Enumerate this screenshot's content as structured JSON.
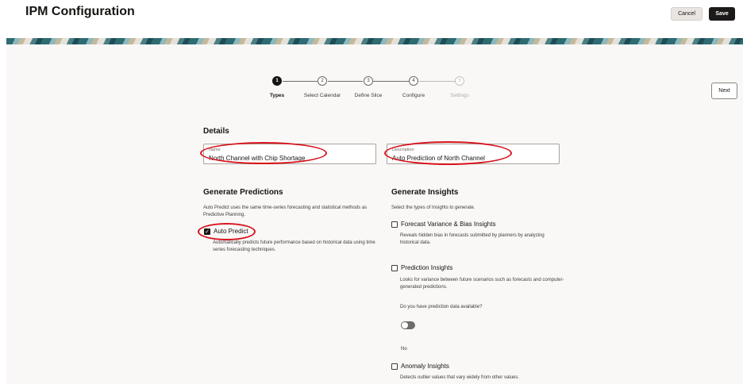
{
  "header": {
    "title": "IPM Configuration",
    "cancel_label": "Cancel",
    "save_label": "Save"
  },
  "train": {
    "steps": [
      {
        "number": "1",
        "label": "Types",
        "state": "active"
      },
      {
        "number": "2",
        "label": "Select Calendar",
        "state": "enabled"
      },
      {
        "number": "3",
        "label": "Define Slice",
        "state": "enabled"
      },
      {
        "number": "4",
        "label": "Configure",
        "state": "enabled"
      },
      {
        "number": "5",
        "label": "Settings",
        "state": "disabled"
      }
    ],
    "next_label": "Next"
  },
  "details": {
    "heading": "Details",
    "name": {
      "label": "Name",
      "value": "North Channel with Chip Shortage"
    },
    "description": {
      "label": "Description",
      "value": "Auto Prediction of North Channel"
    }
  },
  "predictions": {
    "heading": "Generate Predictions",
    "intro": "Auto Predict uses the same time-series forecasting and statistical methods as Predictive Planning.",
    "auto_predict": {
      "label": "Auto Predict",
      "checked": true,
      "help": "Automatically predicts future performance based on historical data using time series forecasting techniques."
    }
  },
  "insights": {
    "heading": "Generate Insights",
    "intro": "Select the types of Insights to generate.",
    "forecast_variance": {
      "label": "Forecast Variance & Bias Insights",
      "checked": false,
      "help": "Reveals hidden bias in forecasts submitted by planners by analyzing historical data."
    },
    "prediction": {
      "label": "Prediction Insights",
      "checked": false,
      "help": "Looks for variance between future scenarios such as forecasts and computer-generated predictions."
    },
    "prediction_data_question": "Do you have prediction data available?",
    "prediction_data_toggle_value": "No",
    "anomaly": {
      "label": "Anomaly Insights",
      "checked": false,
      "help": "Detects outlier values that vary widely from other values."
    }
  },
  "colors": {
    "annotation_red": "#d8121b",
    "primary_dark": "#1c1a18",
    "panel_bg": "#f9f8f7"
  }
}
